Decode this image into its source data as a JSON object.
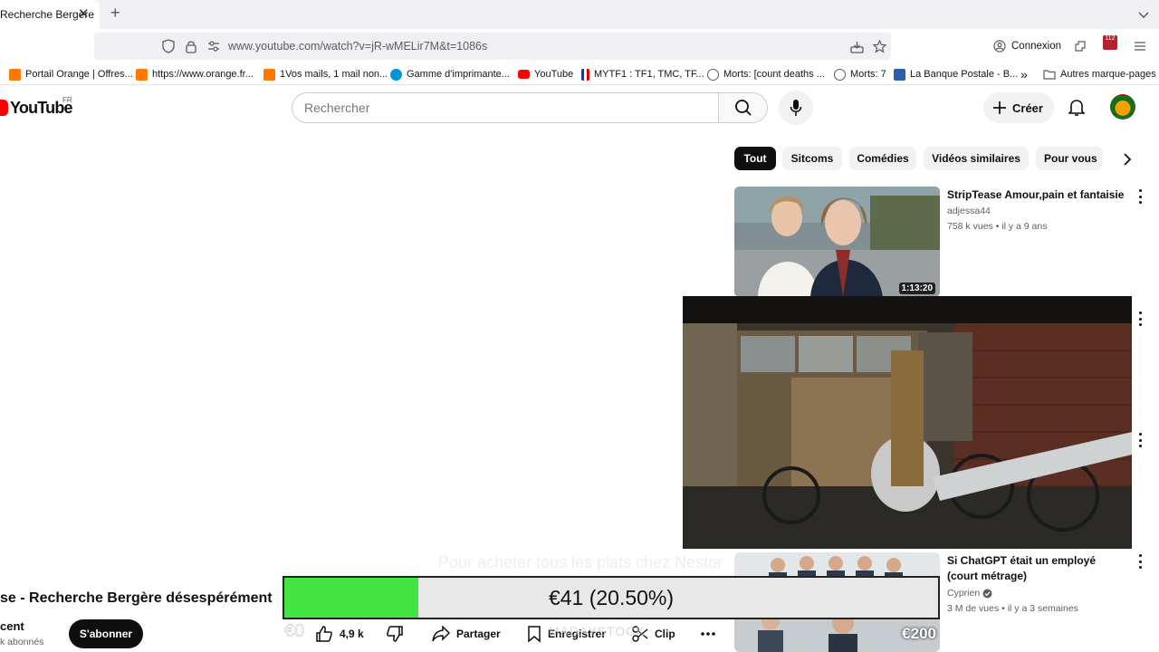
{
  "browser": {
    "tab_title": "Recherche Bergère",
    "url": "www.youtube.com/watch?v=jR-wMELir7M&t=1086s",
    "connexion_label": "Connexion",
    "extension_badge": "112",
    "bookmarks": [
      {
        "label": "Portail Orange | Offres...",
        "color": "#ff7900"
      },
      {
        "label": "https://www.orange.fr...",
        "color": "#ff7900"
      },
      {
        "label": "1Vos mails, 1 mail non...",
        "color": "#ff7900"
      },
      {
        "label": "Gamme d'imprimante...",
        "color": "#0096d6"
      },
      {
        "label": "YouTube",
        "color": "#ff0000"
      },
      {
        "label": "MYTF1 : TF1, TMC, TF...",
        "color": "#1e3a8a"
      },
      {
        "label": "Morts: [count deaths ...",
        "color": "#5b5b66"
      },
      {
        "label": "Morts: 7",
        "color": "#5b5b66"
      },
      {
        "label": "La Banque Postale - B...",
        "color": "#2b5fab"
      }
    ],
    "bookmarks_more": "»",
    "other_bookmarks": "Autres marque-pages"
  },
  "youtube": {
    "logo_text": "YouTube",
    "country": "FR",
    "search_placeholder": "Rechercher",
    "create_label": "Créer",
    "chips": [
      "Tout",
      "Sitcoms",
      "Comédies",
      "Vidéos similaires",
      "Pour vous"
    ],
    "active_chip": "Tout"
  },
  "recommendations": [
    {
      "title": "StripTease Amour,pain et fantaisie",
      "channel": "adjessa44",
      "stats": "758 k vues • il y a 9 ans",
      "duration": "1:13:20"
    },
    {
      "title": "Si ChatGPT était un employé (court métrage)",
      "channel": "Cyprien",
      "verified": true,
      "stats": "3 M de vues • il y a 3 semaines"
    }
  ],
  "video": {
    "title": "se - Recherche Bergère désespérément",
    "channel": "cent",
    "subscribers": "k abonnés",
    "subscribe_label": "S'abonner",
    "likes": "4,9 k",
    "share_label": "Partager",
    "save_label": "Enregistrer",
    "clip_label": "Clip"
  },
  "overlay": {
    "subtitle": "Pour acheter tous les plats chez Nestor",
    "progress_label": "€41 (20.50%)",
    "progress_fraction": 0.205,
    "goal_start": "€0",
    "goal_end": "€200",
    "ghost_text": "MADAYSTOCK",
    "progress_color": "#43e543"
  }
}
